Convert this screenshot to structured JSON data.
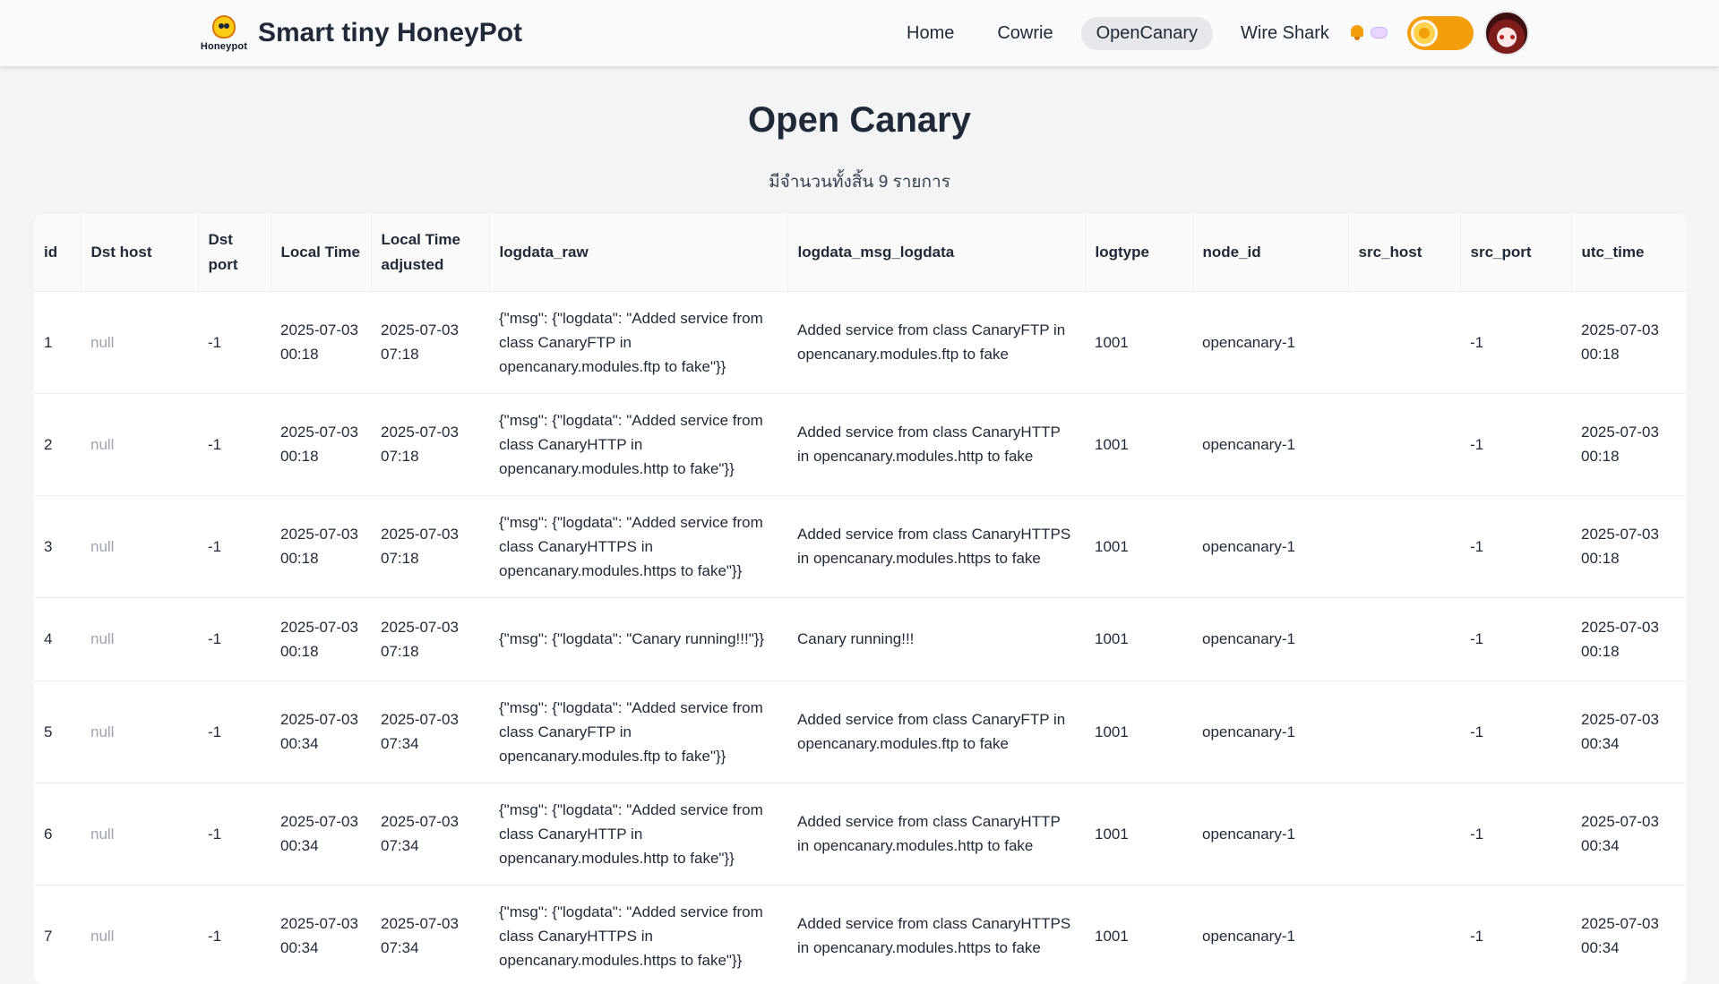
{
  "brand": {
    "logo_text": "Honeypot",
    "title": "Smart tiny HoneyPot"
  },
  "nav": {
    "links": [
      {
        "label": "Home"
      },
      {
        "label": "Cowrie"
      },
      {
        "label": "OpenCanary"
      },
      {
        "label": "Wire Shark"
      }
    ],
    "active": "OpenCanary"
  },
  "page": {
    "title": "Open Canary",
    "count_text": "มีจำนวนทั้งสิ้น 9 รายการ"
  },
  "table": {
    "headers": [
      "id",
      "Dst host",
      "Dst port",
      "Local Time",
      "Local Time adjusted",
      "logdata_raw",
      "logdata_msg_logdata",
      "logtype",
      "node_id",
      "src_host",
      "src_port",
      "utc_time"
    ],
    "rows": [
      {
        "id": "1",
        "dst_host": "null",
        "dst_port": "-1",
        "local_time": "2025-07-03 00:18",
        "local_time_adjusted": "2025-07-03 07:18",
        "logdata_raw": "{\"msg\": {\"logdata\": \"Added service from class CanaryFTP in opencanary.modules.ftp to fake\"}}",
        "logdata_msg_logdata": "Added service from class CanaryFTP in opencanary.modules.ftp to fake",
        "logtype": "1001",
        "node_id": "opencanary-1",
        "src_host": "",
        "src_port": "-1",
        "utc_time": "2025-07-03 00:18"
      },
      {
        "id": "2",
        "dst_host": "null",
        "dst_port": "-1",
        "local_time": "2025-07-03 00:18",
        "local_time_adjusted": "2025-07-03 07:18",
        "logdata_raw": "{\"msg\": {\"logdata\": \"Added service from class CanaryHTTP in opencanary.modules.http to fake\"}}",
        "logdata_msg_logdata": "Added service from class CanaryHTTP in opencanary.modules.http to fake",
        "logtype": "1001",
        "node_id": "opencanary-1",
        "src_host": "",
        "src_port": "-1",
        "utc_time": "2025-07-03 00:18"
      },
      {
        "id": "3",
        "dst_host": "null",
        "dst_port": "-1",
        "local_time": "2025-07-03 00:18",
        "local_time_adjusted": "2025-07-03 07:18",
        "logdata_raw": "{\"msg\": {\"logdata\": \"Added service from class CanaryHTTPS in opencanary.modules.https to fake\"}}",
        "logdata_msg_logdata": "Added service from class CanaryHTTPS in opencanary.modules.https to fake",
        "logtype": "1001",
        "node_id": "opencanary-1",
        "src_host": "",
        "src_port": "-1",
        "utc_time": "2025-07-03 00:18"
      },
      {
        "id": "4",
        "dst_host": "null",
        "dst_port": "-1",
        "local_time": "2025-07-03 00:18",
        "local_time_adjusted": "2025-07-03 07:18",
        "logdata_raw": "{\"msg\": {\"logdata\": \"Canary running!!!\"}}",
        "logdata_msg_logdata": "Canary running!!!",
        "logtype": "1001",
        "node_id": "opencanary-1",
        "src_host": "",
        "src_port": "-1",
        "utc_time": "2025-07-03 00:18"
      },
      {
        "id": "5",
        "dst_host": "null",
        "dst_port": "-1",
        "local_time": "2025-07-03 00:34",
        "local_time_adjusted": "2025-07-03 07:34",
        "logdata_raw": "{\"msg\": {\"logdata\": \"Added service from class CanaryFTP in opencanary.modules.ftp to fake\"}}",
        "logdata_msg_logdata": "Added service from class CanaryFTP in opencanary.modules.ftp to fake",
        "logtype": "1001",
        "node_id": "opencanary-1",
        "src_host": "",
        "src_port": "-1",
        "utc_time": "2025-07-03 00:34"
      },
      {
        "id": "6",
        "dst_host": "null",
        "dst_port": "-1",
        "local_time": "2025-07-03 00:34",
        "local_time_adjusted": "2025-07-03 07:34",
        "logdata_raw": "{\"msg\": {\"logdata\": \"Added service from class CanaryHTTP in opencanary.modules.http to fake\"}}",
        "logdata_msg_logdata": "Added service from class CanaryHTTP in opencanary.modules.http to fake",
        "logtype": "1001",
        "node_id": "opencanary-1",
        "src_host": "",
        "src_port": "-1",
        "utc_time": "2025-07-03 00:34"
      },
      {
        "id": "7",
        "dst_host": "null",
        "dst_port": "-1",
        "local_time": "2025-07-03 00:34",
        "local_time_adjusted": "2025-07-03 07:34",
        "logdata_raw": "{\"msg\": {\"logdata\": \"Added service from class CanaryHTTPS in opencanary.modules.https to fake\"}}",
        "logdata_msg_logdata": "Added service from class CanaryHTTPS in opencanary.modules.https to fake",
        "logtype": "1001",
        "node_id": "opencanary-1",
        "src_host": "",
        "src_port": "-1",
        "utc_time": "2025-07-03 00:34"
      }
    ]
  },
  "icons": {
    "logo": "honeypot-bird-logo",
    "notification": "bell-icon",
    "chat": "chat-bubble-icon",
    "theme_toggle": "theme-toggle",
    "avatar": "user-avatar"
  },
  "colors": {
    "accent_toggle": "#f59e0b",
    "null_text": "#9ca3af",
    "active_nav_bg": "#e5e7eb"
  }
}
